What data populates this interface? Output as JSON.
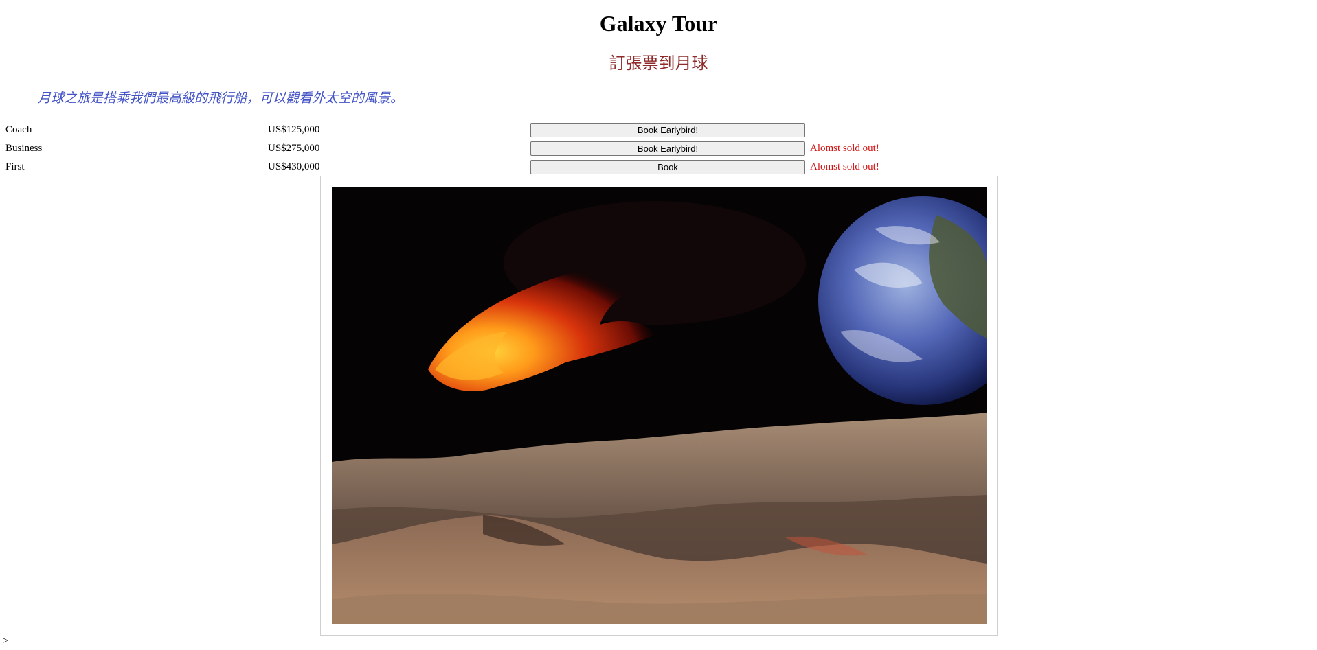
{
  "header": {
    "title": "Galaxy Tour",
    "subtitle": "訂張票到月球",
    "intro": "月球之旅是搭乘我們最高級的飛行船，可以觀看外太空的風景。"
  },
  "tickets": [
    {
      "class": "Coach",
      "price": "US$125,000",
      "button": "Book Earlybird!",
      "status": ""
    },
    {
      "class": "Business",
      "price": "US$275,000",
      "button": "Book Earlybird!",
      "status": "Alomst sold out!"
    },
    {
      "class": "First",
      "price": "US$430,000",
      "button": "Book",
      "status": "Alomst sold out!"
    }
  ],
  "footer": {
    "prompt": ">"
  },
  "colors": {
    "subtitle": "#8e2a2a",
    "intro": "#4454c7",
    "status": "#d01010"
  }
}
